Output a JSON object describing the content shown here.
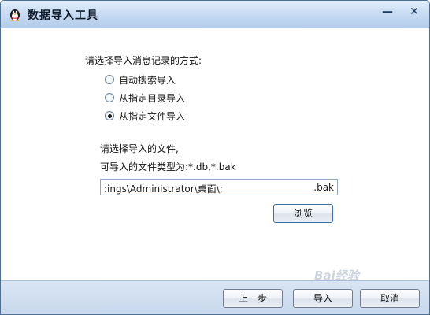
{
  "window": {
    "title": "数据导入工具",
    "minimize_symbol": "—",
    "close_symbol": "✕",
    "icon": "qq-penguin-icon"
  },
  "content": {
    "prompt_method": "请选择导入消息记录的方式:",
    "options": [
      {
        "label": "自动搜索导入",
        "checked": false
      },
      {
        "label": "从指定目录导入",
        "checked": false
      },
      {
        "label": "从指定文件导入",
        "checked": true
      }
    ],
    "prompt_file": "请选择导入的文件,",
    "file_types": "可导入的文件类型为:*.db,*.bak",
    "path_value_left": ":ings\\Administrator\\桌面\\;",
    "path_value_right": ".bak",
    "browse_label": "浏览"
  },
  "footer": {
    "prev_label": "上一步",
    "import_label": "导入",
    "cancel_label": "取消"
  },
  "watermark": "Bai经验"
}
